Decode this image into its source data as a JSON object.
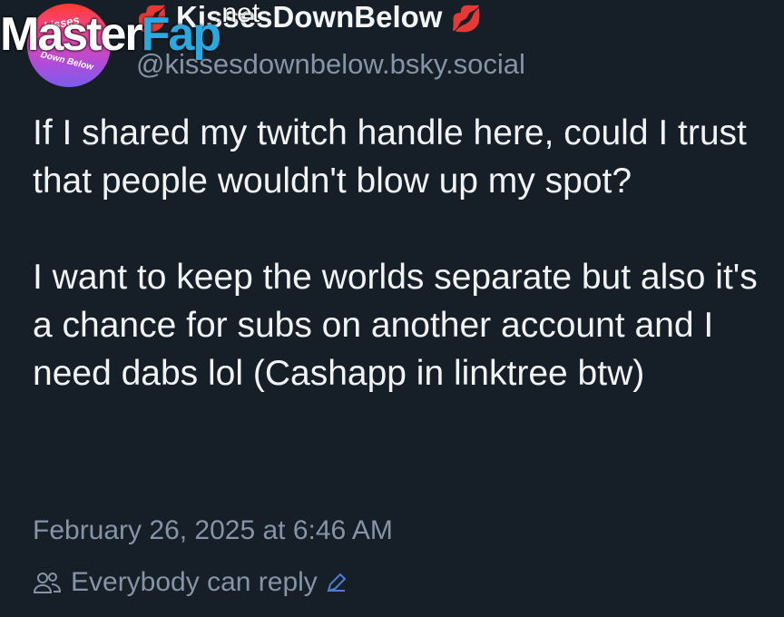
{
  "watermark": {
    "master": "Master",
    "fap": "Fap",
    "net": ".net"
  },
  "avatar": {
    "top_text": "kisses",
    "bottom_text": "Down Below"
  },
  "author": {
    "display_name": "KissesDownBelow",
    "handle": "@kissesdownbelow.bsky.social",
    "emoji_icon": "lips-icon"
  },
  "post": {
    "paragraphs": [
      "If I shared my twitch handle here, could I trust that people wouldn't blow up my spot?",
      "I want to keep the worlds separate but also it's a chance for subs on another account and I need dabs lol (Cashapp in linktree btw)"
    ],
    "timestamp": "February 26, 2025 at 6:46 AM",
    "reply_setting": "Everybody can reply"
  },
  "colors": {
    "background": "#161e27",
    "text": "#f1f3f5",
    "muted": "#8594a6",
    "accent": "#4a7fd4"
  }
}
